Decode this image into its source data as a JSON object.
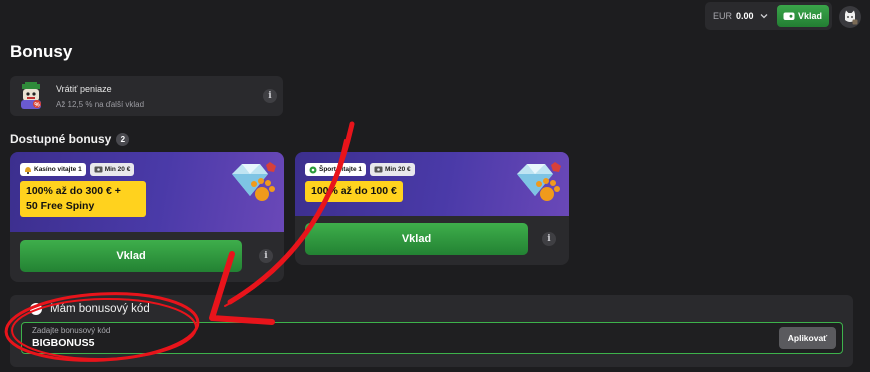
{
  "header": {
    "currency": "EUR",
    "balance": "0.00",
    "deposit_label": "Vklad"
  },
  "page": {
    "title": "Bonusy"
  },
  "cashback": {
    "title": "Vrátiť peniaze",
    "subtitle": "Až 12,5 % na ďalší vklad",
    "info": "i"
  },
  "available": {
    "title": "Dostupné bonusy",
    "count": "2"
  },
  "bonuses": [
    {
      "category": "Kasíno vitajte 1",
      "min": "Min 20 €",
      "headline_line1": "100% až do 300 € +",
      "headline_line2": "50 Free Spiny",
      "button": "Vklad",
      "info": "i"
    },
    {
      "category": "Šport vitajte 1",
      "min": "Min 20 €",
      "headline_line1": "100% až do 100 €",
      "button": "Vklad",
      "info": "i"
    }
  ],
  "promo": {
    "toggle_label": "Mám bonusový kód",
    "field_label": "Zadajte bonusový kód",
    "value": "BIGBONUS5",
    "apply": "Aplikovať"
  },
  "colors": {
    "accent_green": "#2f9a3f",
    "headline_yellow": "#ffd21e",
    "annotation_red": "#e8141b"
  }
}
